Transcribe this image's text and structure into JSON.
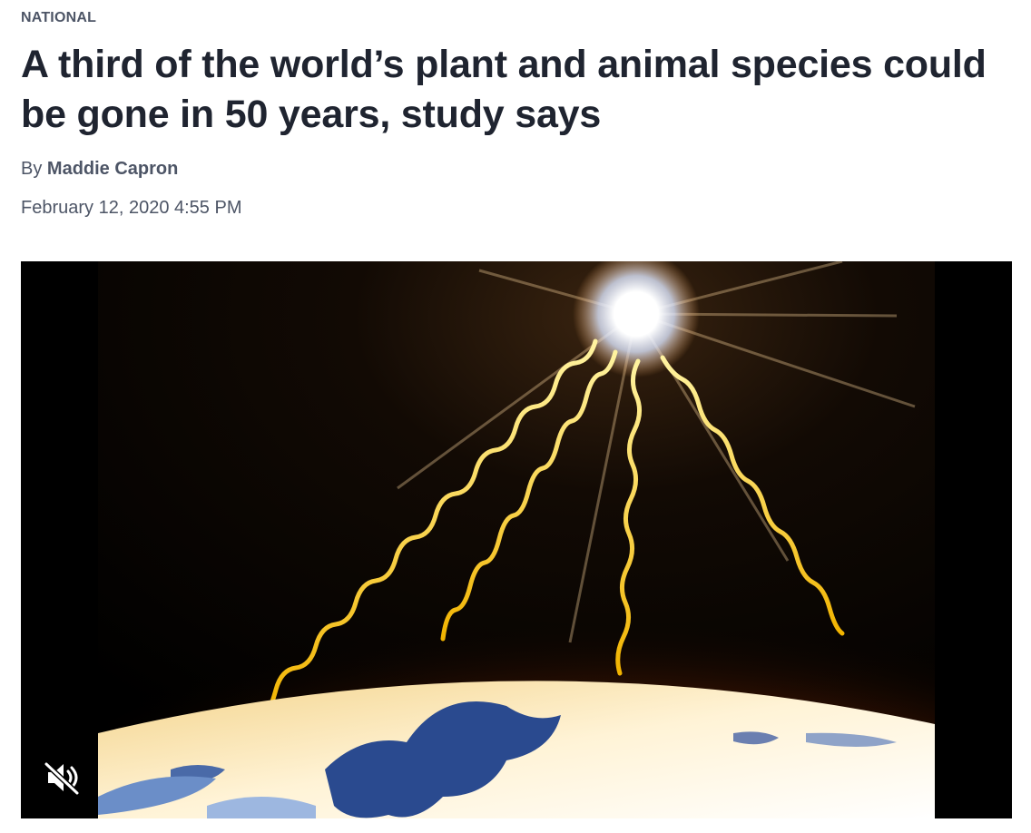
{
  "article": {
    "section": "NATIONAL",
    "headline": "A third of the world’s plant and animal species could be gone in 50 years, study says",
    "byline_prefix": "By",
    "author": "Maddie Capron",
    "date": "February 12, 2020 4:55 PM"
  },
  "video": {
    "mute_icon": "speaker-muted-icon"
  }
}
